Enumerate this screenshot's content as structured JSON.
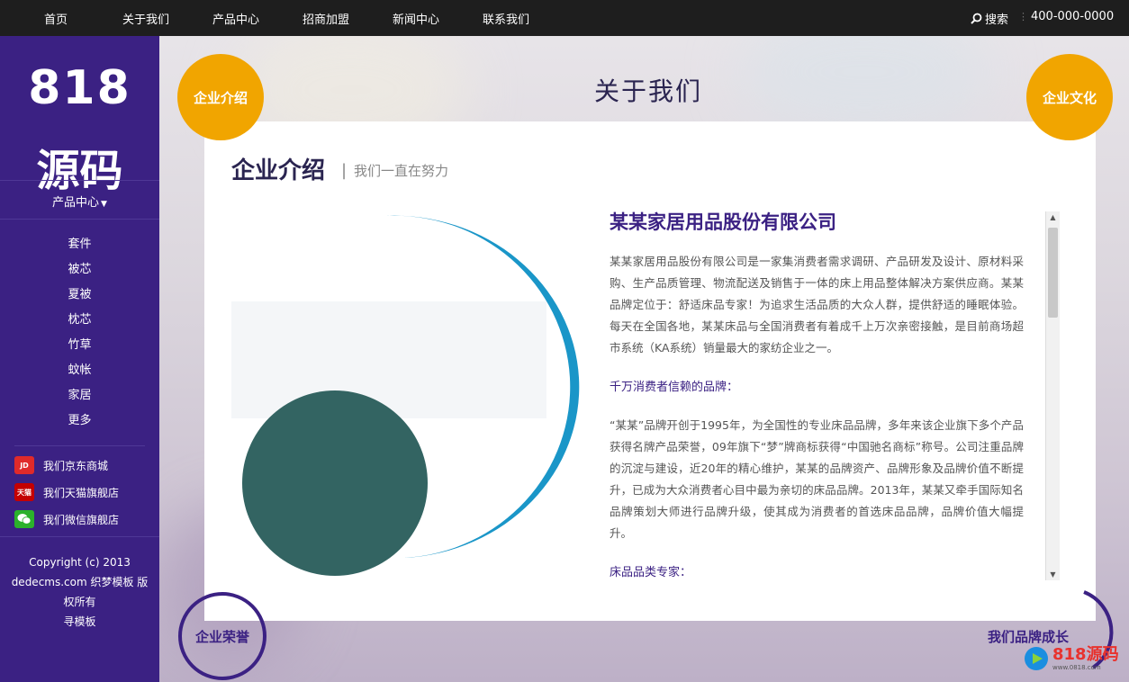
{
  "nav": {
    "items": [
      "首页",
      "关于我们",
      "产品中心",
      "招商加盟",
      "新闻中心",
      "联系我们"
    ],
    "search_label": "搜索",
    "phone": "400-000-0000"
  },
  "sidebar": {
    "logo_number": "818",
    "logo_text": "源码",
    "product_center": "产品中心",
    "categories": [
      "套件",
      "被芯",
      "夏被",
      "枕芯",
      "竹草",
      "蚊帐",
      "家居",
      "更多"
    ],
    "shops": [
      {
        "label": "我们京东商城",
        "icon": "jd-icon",
        "badge": "JD"
      },
      {
        "label": "我们天猫旗舰店",
        "icon": "tmall-icon",
        "badge": "天猫"
      },
      {
        "label": "我们微信旗舰店",
        "icon": "wechat-icon",
        "badge": ""
      }
    ],
    "copyright": [
      "Copyright (c) 2013",
      "dedecms.com 织梦模板 版",
      "权所有",
      "寻模板"
    ]
  },
  "page": {
    "title": "关于我们",
    "circle_intro": "企业介绍",
    "circle_culture": "企业文化",
    "circle_honor": "企业荣誉",
    "brand_growth": "我们品牌成长"
  },
  "section": {
    "title": "企业介绍",
    "separator": "|",
    "subtitle": "我们一直在努力",
    "company": "某某家居用品股份有限公司",
    "para1": "某某家居用品股份有限公司是一家集消费者需求调研、产品研发及设计、原材料采购、生产品质管理、物流配送及销售于一体的床上用品整体解决方案供应商。某某品牌定位于：舒适床品专家！为追求生活品质的大众人群，提供舒适的睡眠体验。每天在全国各地，某某床品与全国消费者有着成千上万次亲密接触，是目前商场超市系统（KA系统）销量最大的家纺企业之一。",
    "subhead1": "千万消费者信赖的品牌：",
    "para2": "“某某”品牌开创于1995年，为全国性的专业床品品牌，多年来该企业旗下多个产品获得名牌产品荣誉，09年旗下“梦”牌商标获得“中国驰名商标”称号。公司注重品牌的沉淀与建设，近20年的精心维护，某某的品牌资产、品牌形象及品牌价值不断提升，已成为大众消费者心目中最为亲切的床品品牌。2013年，某某又牵手国际知名品牌策划大师进行品牌升级，使其成为消费者的首选床品品牌，品牌价值大幅提升。",
    "subhead2": "床品品类专家："
  },
  "watermark": {
    "text": "818源码",
    "url": "www.0818.com"
  },
  "colors": {
    "purple": "#3b2183",
    "orange": "#f1a500",
    "blue_arc": "#1a96c8",
    "teal_circle": "#336462"
  }
}
